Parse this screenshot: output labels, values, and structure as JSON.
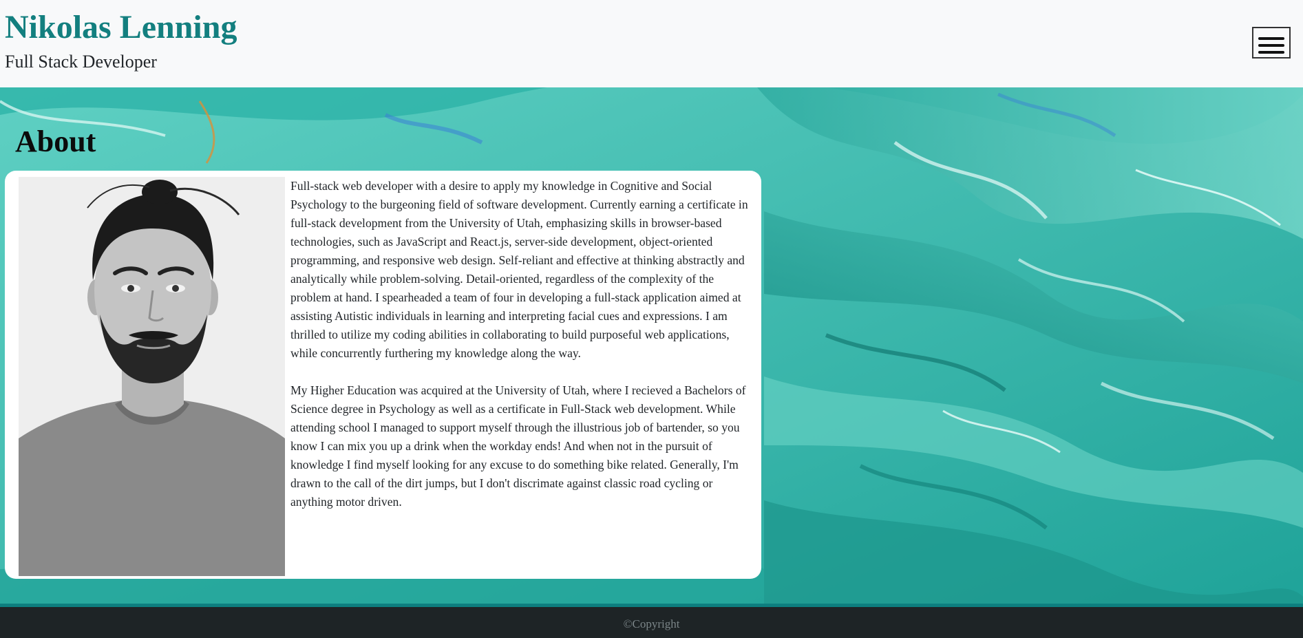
{
  "header": {
    "name": "Nikolas Lenning",
    "subtitle": "Full Stack Developer",
    "menu_icon": "hamburger-menu-icon"
  },
  "about": {
    "heading": "About",
    "portrait_alt": "Portrait photo",
    "paragraphs": [
      "Full-stack web developer with a desire to apply my knowledge in Cognitive and Social Psychology to the burgeoning field of software development. Currently earning a certificate in full-stack development from the University of Utah, emphasizing skills in browser-based technologies, such as JavaScript and React.js, server-side development, object-oriented programming, and responsive web design. Self-reliant and effective at thinking abstractly and analytically while problem-solving. Detail-oriented, regardless of the complexity of the problem at hand. I spearheaded a team of four in developing a full-stack application aimed at assisting Autistic individuals in learning and interpreting facial cues and expressions. I am thrilled to utilize my coding abilities in collaborating to build purposeful web applications, while concurrently furthering my knowledge along the way.",
      "My Higher Education was acquired at the University of Utah, where I recieved a Bachelors of Science degree in Psychology as well as a certificate in Full-Stack web development. While attending school I managed to support myself through the illustrious job of bartender, so you know I can mix you up a drink when the workday ends! And when not in the pursuit of knowledge I find myself looking for any excuse to do something bike related. Generally, I'm drawn to the call of the dirt jumps, but I don't discrimate against classic road cycling or anything motor driven."
    ]
  },
  "footer": {
    "copyright": "©Copyright"
  },
  "colors": {
    "brand": "#137f7f",
    "header_bg": "#f8f9fa",
    "hero_teal": "#35b8ac",
    "footer_bg": "#1e2426",
    "footer_border": "#0d7f7f"
  }
}
